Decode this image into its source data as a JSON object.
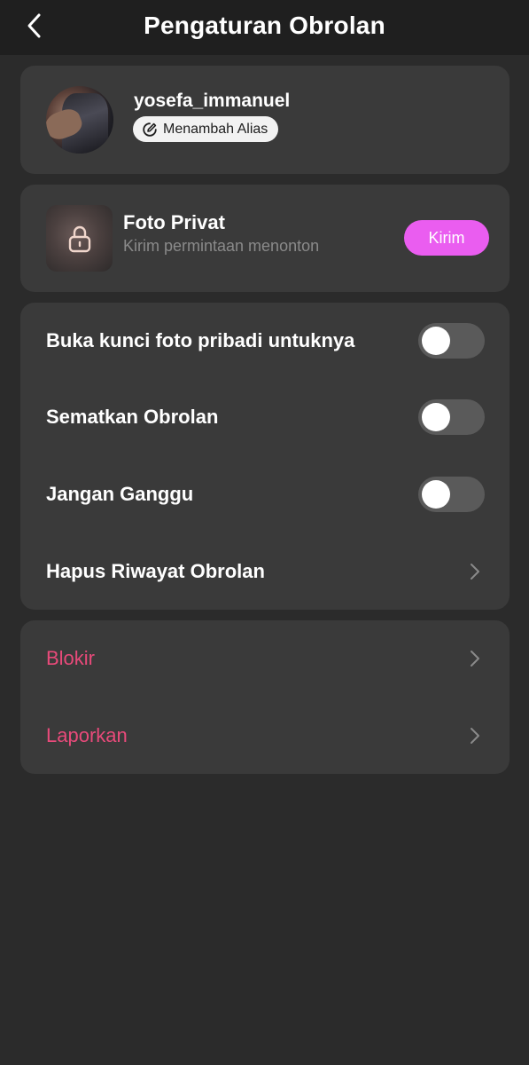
{
  "header": {
    "title": "Pengaturan Obrolan",
    "back_icon": "chevron-left-icon"
  },
  "profile": {
    "username": "yosefa_immanuel",
    "alias_button_label": "Menambah Alias",
    "alias_icon": "edit-icon"
  },
  "private_photo": {
    "title": "Foto Privat",
    "subtitle": "Kirim permintaan menonton",
    "send_button_label": "Kirim",
    "lock_icon": "lock-icon",
    "accent_color": "#ea5df0"
  },
  "settings": {
    "items": [
      {
        "label": "Buka kunci foto pribadi untuknya",
        "control": "toggle",
        "on": false
      },
      {
        "label": "Sematkan Obrolan",
        "control": "toggle",
        "on": false
      },
      {
        "label": "Jangan Ganggu",
        "control": "toggle",
        "on": false
      },
      {
        "label": "Hapus Riwayat Obrolan",
        "control": "chevron"
      }
    ]
  },
  "danger": {
    "items": [
      {
        "label": "Blokir",
        "control": "chevron"
      },
      {
        "label": "Laporkan",
        "control": "chevron"
      }
    ],
    "color": "#e84a7a"
  }
}
